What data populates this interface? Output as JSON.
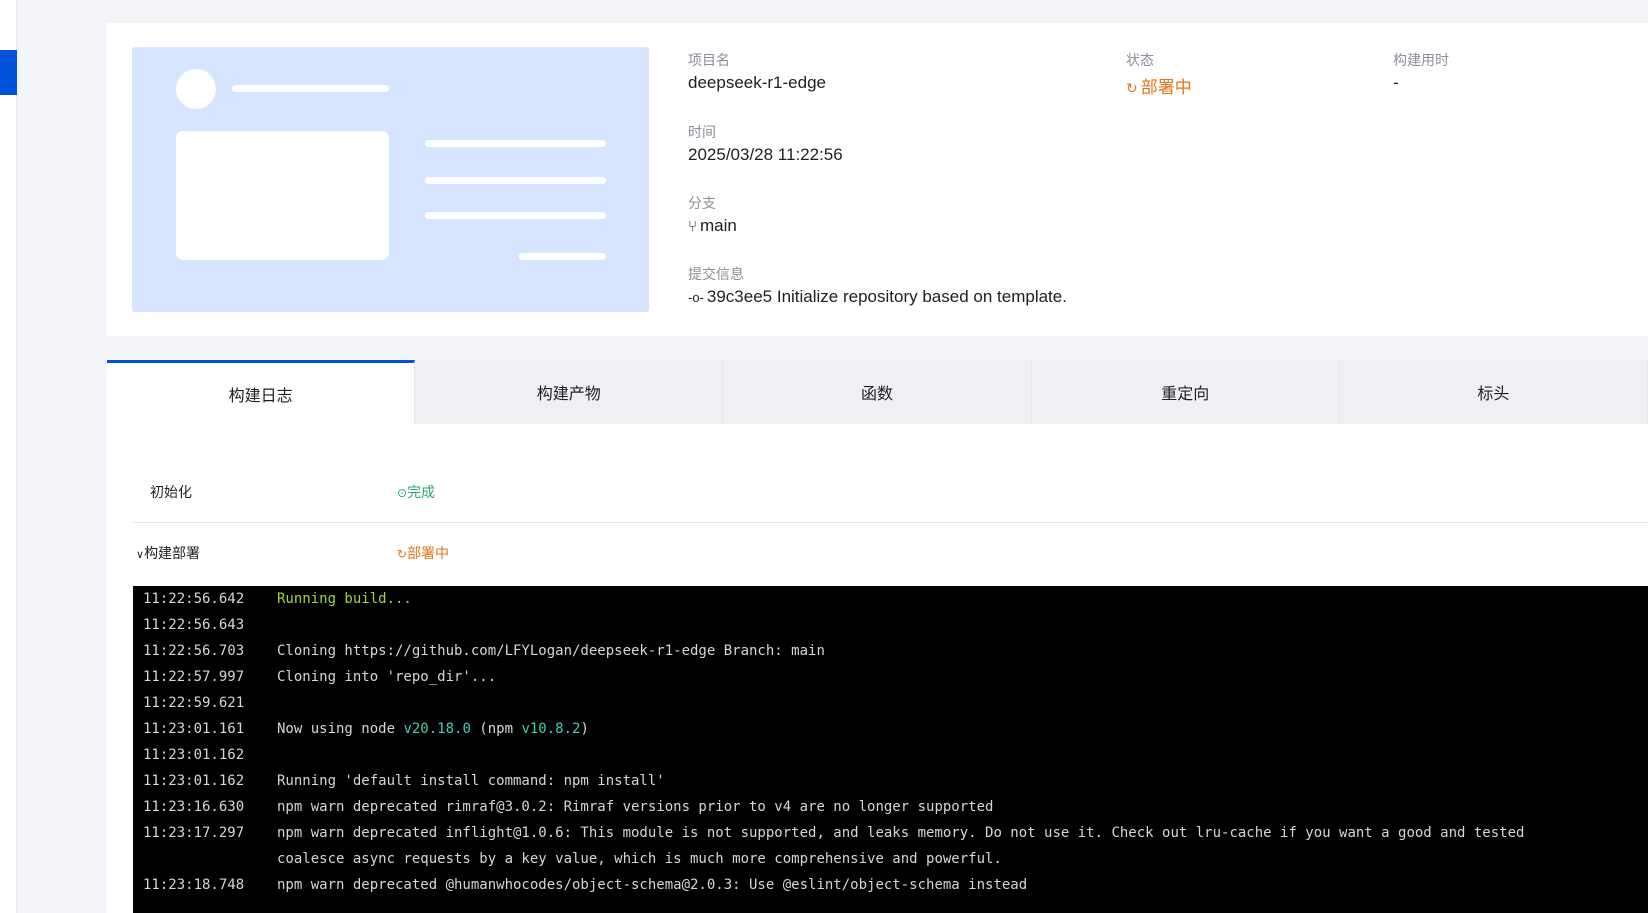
{
  "project": {
    "name_label": "项目名",
    "name": "deepseek-r1-edge",
    "status_label": "状态",
    "status": "部署中",
    "duration_label": "构建用时",
    "duration": "-",
    "time_label": "时间",
    "time": "2025/03/28 11:22:56",
    "branch_label": "分支",
    "branch": "main",
    "commit_label": "提交信息",
    "commit": "39c3ee5 Initialize repository based on template."
  },
  "tabs": [
    {
      "label": "构建日志",
      "active": true
    },
    {
      "label": "构建产物",
      "active": false
    },
    {
      "label": "函数",
      "active": false
    },
    {
      "label": "重定向",
      "active": false
    },
    {
      "label": "标头",
      "active": false
    }
  ],
  "steps": [
    {
      "name": "初始化",
      "status": "完成",
      "status_icon": "check-circle-icon"
    },
    {
      "name": "构建部署",
      "status": "部署中",
      "status_icon": "spinner-icon",
      "expanded": true
    }
  ],
  "logs": [
    {
      "ts": "11:22:56.642",
      "msg": "Running build..."
    },
    {
      "ts": "11:22:56.643",
      "msg": ""
    },
    {
      "ts": "11:22:56.703",
      "msg": "Cloning https://github.com/LFYLogan/deepseek-r1-edge Branch: main"
    },
    {
      "ts": "11:22:57.997",
      "msg": "Cloning into 'repo_dir'..."
    },
    {
      "ts": "11:22:59.621",
      "msg": ""
    },
    {
      "ts": "11:23:01.161",
      "msg_prefix": "Now using node ",
      "node_ver": "v20.18.0",
      "msg_mid": " (npm ",
      "npm_ver": "v10.8.2",
      "msg_suffix": ")"
    },
    {
      "ts": "11:23:01.162",
      "msg": ""
    },
    {
      "ts": "11:23:01.162",
      "msg": "Running 'default install command: npm install'"
    },
    {
      "ts": "11:23:16.630",
      "msg": "npm warn deprecated rimraf@3.0.2: Rimraf versions prior to v4 are no longer supported"
    },
    {
      "ts": "11:23:17.297",
      "msg": "npm warn deprecated inflight@1.0.6: This module is not supported, and leaks memory. Do not use it. Check out lru-cache if you want a good and tested"
    },
    {
      "ts": "",
      "msg": "coalesce async requests by a key value, which is much more comprehensive and powerful."
    },
    {
      "ts": "11:23:18.748",
      "msg": "npm warn deprecated @humanwhocodes/object-schema@2.0.3: Use @eslint/object-schema instead"
    }
  ],
  "colors": {
    "accent": "#0052d9",
    "deploying": "#e37318",
    "done": "#2ba471",
    "console_bg": "#000000",
    "log_green": "#9fd63f",
    "log_cyan": "#3fd0b3"
  }
}
